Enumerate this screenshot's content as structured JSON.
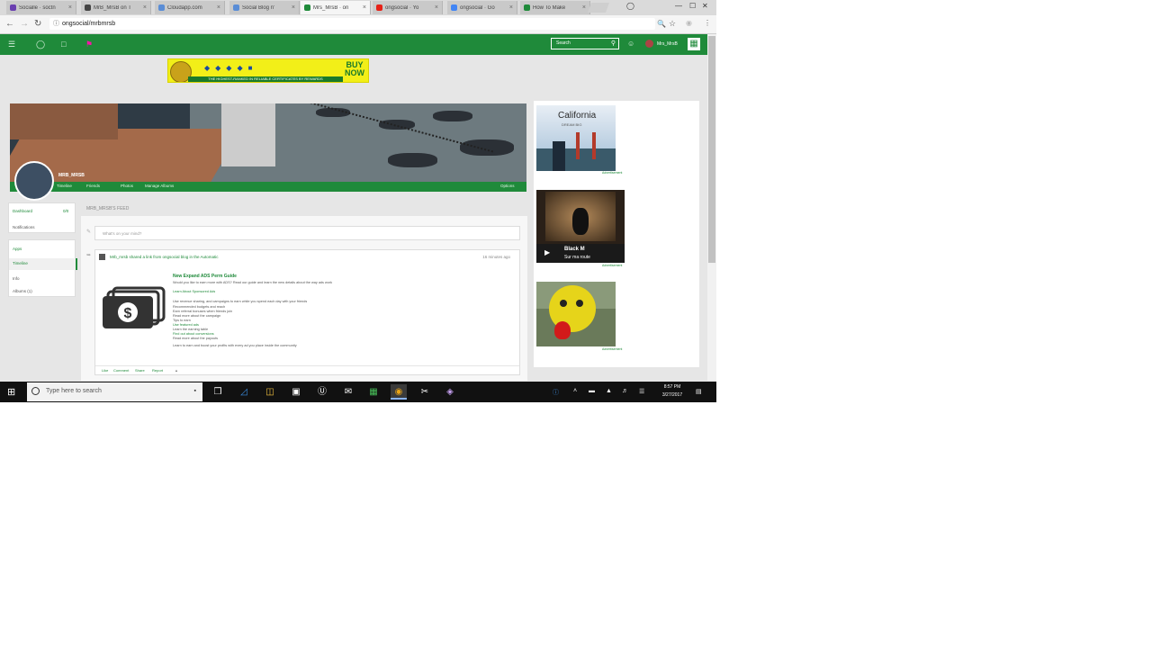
{
  "browser": {
    "tabs": [
      {
        "title": "Socialle · soctn",
        "color": "#6a3fb0",
        "active": false
      },
      {
        "title": "MrB_MrsB on T",
        "color": "#444444",
        "active": false
      },
      {
        "title": "Cloudapp.com",
        "color": "#5a8dd6",
        "active": false
      },
      {
        "title": "Social Blog n'",
        "color": "#5a8dd6",
        "active": false
      },
      {
        "title": "Mrs_MrsB · on",
        "color": "#1f8a3a",
        "active": true
      },
      {
        "title": "ongsocial · Yo",
        "color": "#e62117",
        "active": false
      },
      {
        "title": "ongsocial · Go",
        "color": "#4285f4",
        "active": false
      },
      {
        "title": "How To Make",
        "color": "#1f8a3a",
        "active": false
      }
    ],
    "url": "ongsocial/mrbmrsb",
    "window_controls": [
      "—",
      "☐",
      "✕"
    ]
  },
  "site": {
    "search_placeholder": "Search",
    "username": "Mrs_MrsB"
  },
  "ad_banner": {
    "cta": "BUY NOW",
    "strip_text": "THE HIGHEST-RANKED IN RELIABLE CERTIFICATES BY REWARDS"
  },
  "profile": {
    "name": "MRB_MRSB",
    "cover_links": [
      "Timeline",
      "Friends",
      "Photos",
      "Manage Albums"
    ],
    "cover_right": "Options"
  },
  "sidebar": {
    "box1": [
      {
        "label": "Dashboard",
        "count": "0/0"
      },
      {
        "label": "Notifications"
      }
    ],
    "box2": [
      {
        "label": "Apps"
      },
      {
        "label": "Timeline"
      },
      {
        "label": "Info"
      },
      {
        "label": "Albums (1)"
      }
    ]
  },
  "feed": {
    "title": "MRB_MRSB'S FEED",
    "status_placeholder": "What's on your mind?",
    "post": {
      "header": "Mrb_mrsb shared a link from ongsocial blog in the Automatic",
      "time": "16 minutes ago",
      "title": "New Expand ADS Perm Guide",
      "lines": [
        "Would you like to earn more with ADS? Read our guide and learn the new details about the way ads work",
        "Learn About Sponsored Ads",
        "Use revenue sharing, and campaigns to earn while you spend each day with your friends",
        "Recommended budgets and reach",
        "Earn referral bonuses when friends join",
        "Read more about the campaign",
        "Tips to earn",
        "Use featured ads",
        "Learn the earning table",
        "Find out about conversions",
        "Read more about the payouts",
        "Learn to earn and boost your profits with every ad you place inside the community"
      ],
      "actions": [
        "Like",
        "Comment",
        "Share",
        "Report"
      ]
    }
  },
  "right_ads": [
    {
      "title": "California",
      "sub": "DREAM BIG",
      "label": "Advertisement"
    },
    {
      "title": "Black M",
      "sub": "Sur ma route",
      "label": "Advertisement"
    },
    {
      "title": "",
      "sub": "",
      "label": "Advertisement"
    }
  ],
  "taskbar": {
    "search_placeholder": "Type here to search",
    "time": "8:57 PM",
    "date": "3/27/2017"
  },
  "colors": {
    "brand_green": "#1f8a3a",
    "ad_yellow": "#f2ef18"
  }
}
